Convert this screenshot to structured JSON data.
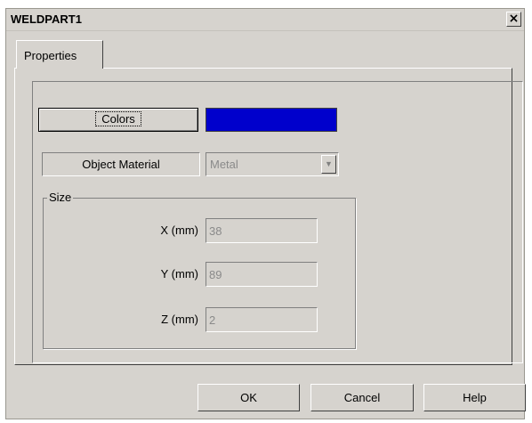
{
  "window": {
    "title": "WELDPART1",
    "close_glyph": "×"
  },
  "tabs": [
    {
      "label": "Properties",
      "active": true
    }
  ],
  "colors": {
    "button_label": "Colors",
    "swatch_color": "#0000cc"
  },
  "material": {
    "label": "Object Material",
    "value": "Metal",
    "arrow_glyph": "▼"
  },
  "size": {
    "legend": "Size",
    "x": {
      "label": "X (mm)",
      "value": "38"
    },
    "y": {
      "label": "Y (mm)",
      "value": "89"
    },
    "z": {
      "label": "Z (mm)",
      "value": "2"
    }
  },
  "buttons": {
    "ok": "OK",
    "cancel": "Cancel",
    "help": "Help"
  }
}
